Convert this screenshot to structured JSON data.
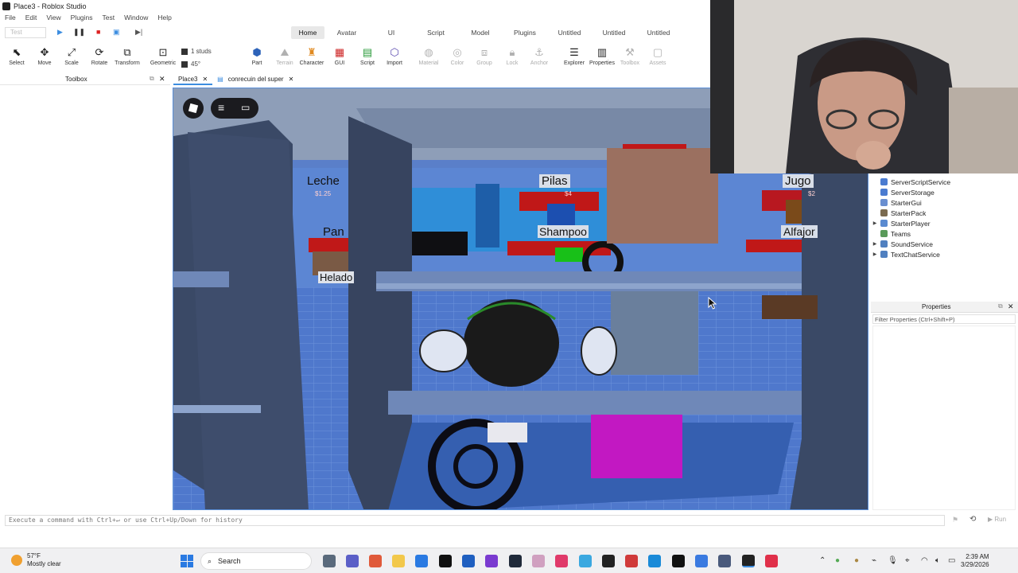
{
  "window": {
    "title": "Place3 - Roblox Studio"
  },
  "menu": [
    "File",
    "Edit",
    "View",
    "Plugins",
    "Test",
    "Window",
    "Help"
  ],
  "test_dropdown": "Test",
  "ribbon_tabs": [
    {
      "label": "Home",
      "active": true
    },
    {
      "label": "Avatar"
    },
    {
      "label": "UI"
    },
    {
      "label": "Script"
    },
    {
      "label": "Model"
    },
    {
      "label": "Plugins"
    },
    {
      "label": "Untitled"
    },
    {
      "label": "Untitled"
    },
    {
      "label": "Untitled"
    }
  ],
  "toolbar": {
    "select": "Select",
    "move": "Move",
    "scale": "Scale",
    "rotate": "Rotate",
    "transform": "Transform",
    "geometric": "Geometric",
    "snap_move": "1 studs",
    "snap_rotate": "45°",
    "part": "Part",
    "terrain": "Terrain",
    "character": "Character",
    "gui": "GUI",
    "script": "Script",
    "import": "Import",
    "material": "Material",
    "color": "Color",
    "group": "Group",
    "lock": "Lock",
    "anchor": "Anchor",
    "explorer": "Explorer",
    "properties": "Properties",
    "toolbox": "Toolbox",
    "assets": "Assets"
  },
  "toolbox": {
    "title": "Toolbox"
  },
  "doc_tabs": [
    {
      "label": "Place3",
      "active": true
    },
    {
      "label": "conrecuin del super"
    }
  ],
  "store_signs": {
    "leche": "Leche",
    "pan": "Pan",
    "helado": "Helado",
    "pilas": "Pilas",
    "shampoo": "Shampoo",
    "jugo": "Jugo",
    "alfajor": "Alfajor",
    "price1": "$1.25",
    "price2": "$4",
    "price3": "$2"
  },
  "explorer": {
    "items": [
      {
        "label": "ServerScriptService",
        "expand": false,
        "color": "#4a7bd0"
      },
      {
        "label": "ServerStorage",
        "expand": false,
        "color": "#4a7bd0"
      },
      {
        "label": "StarterGui",
        "expand": false,
        "color": "#6a8fd0"
      },
      {
        "label": "StarterPack",
        "expand": false,
        "color": "#7a6a50"
      },
      {
        "label": "StarterPlayer",
        "expand": true,
        "color": "#5a8ad0"
      },
      {
        "label": "Teams",
        "expand": false,
        "color": "#5a9a5a"
      },
      {
        "label": "SoundService",
        "expand": true,
        "color": "#5080c0"
      },
      {
        "label": "TextChatService",
        "expand": true,
        "color": "#5080c0"
      }
    ]
  },
  "properties": {
    "title": "Properties",
    "filter_placeholder": "Filter Properties (Ctrl+Shift+P)"
  },
  "command_bar": {
    "placeholder": "Execute a command with Ctrl+↵ or use Ctrl+Up/Down for history",
    "run": "Run"
  },
  "taskbar": {
    "weather_temp": "57°F",
    "weather_desc": "Mostly clear",
    "search": "Search",
    "time": "2:39 AM",
    "date": "3/29/2026"
  }
}
